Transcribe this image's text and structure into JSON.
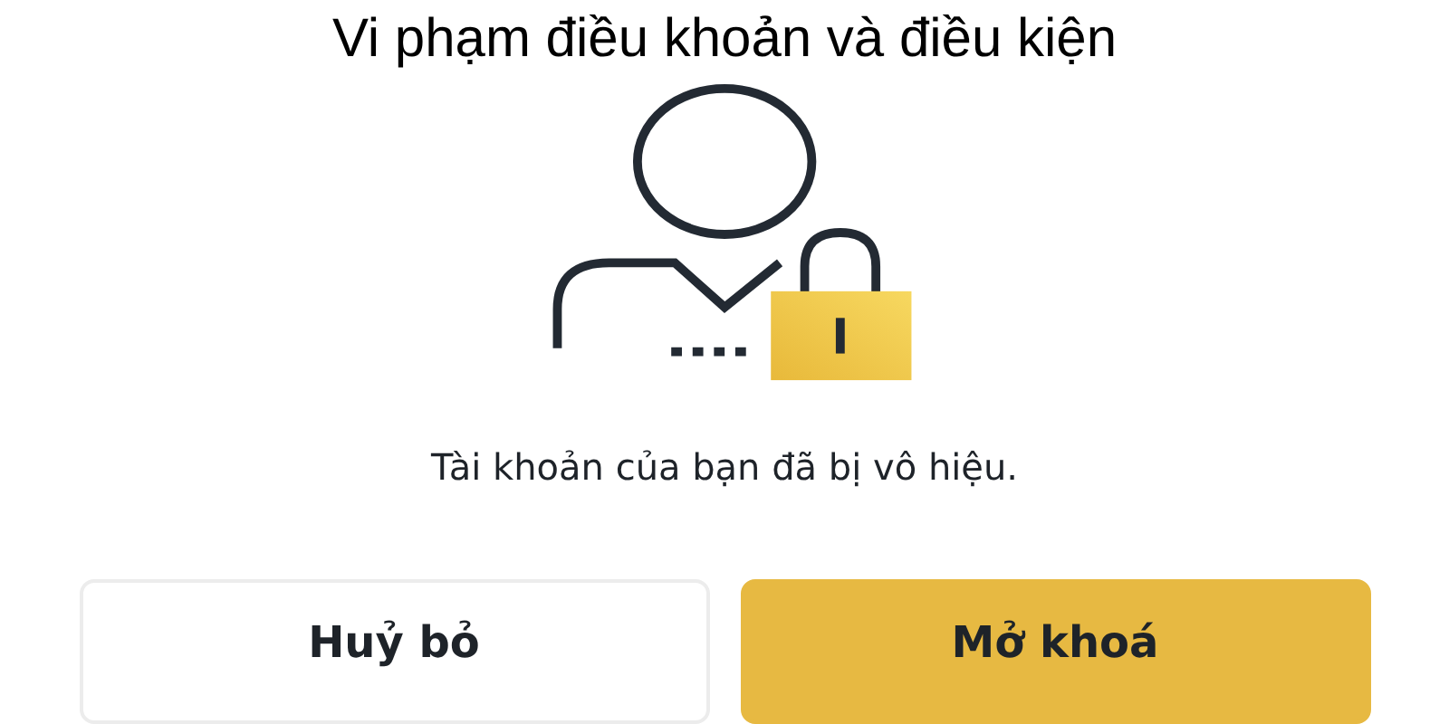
{
  "title": "Vi phạm điều khoản và điều kiện",
  "message": "Tài khoản của bạn đã bị vô hiệu.",
  "buttons": [
    {
      "label": "Huỷ bỏ",
      "kind": "secondary"
    },
    {
      "label": "Mở khoá",
      "kind": "primary"
    }
  ]
}
